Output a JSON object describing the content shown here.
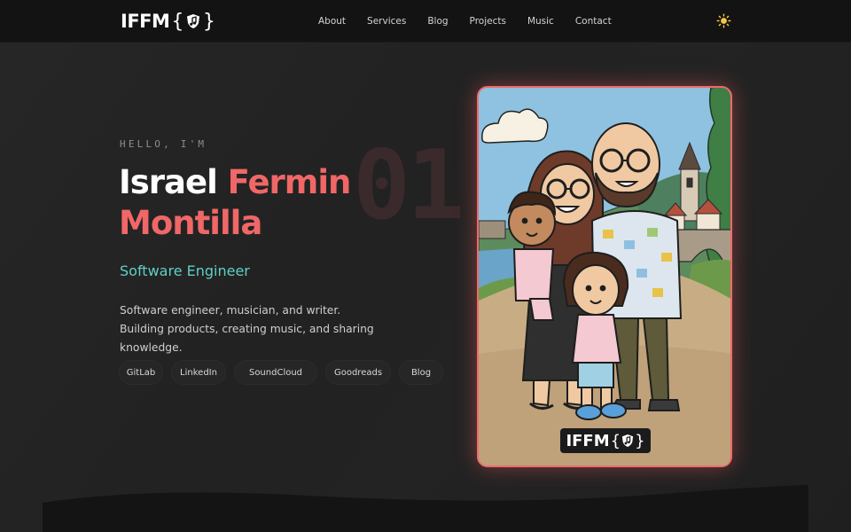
{
  "header": {
    "logo_text": "IFFM",
    "logo_brace_open": "{",
    "logo_brace_close": "}",
    "nav": [
      "About",
      "Services",
      "Blog",
      "Projects",
      "Music",
      "Contact"
    ],
    "theme_icon": "sun-icon"
  },
  "hero": {
    "section_number": "01",
    "greeting": "HELLO, I'M",
    "first_name": "Israel",
    "middle_name": "Fermin",
    "last_name": "Montilla",
    "role": "Software Engineer",
    "bio": "Software engineer, musician, and writer. Building products, creating music, and sharing knowledge.",
    "links": [
      "GitLab",
      "LinkedIn",
      "SoundCloud",
      "Goodreads",
      "Blog"
    ]
  },
  "portrait": {
    "badge_text": "IFFM",
    "badge_brace_open": "{",
    "badge_brace_close": "}"
  },
  "colors": {
    "accent": "#f06767",
    "role": "#5fd0c4",
    "background": "#222222",
    "header": "#131313"
  }
}
